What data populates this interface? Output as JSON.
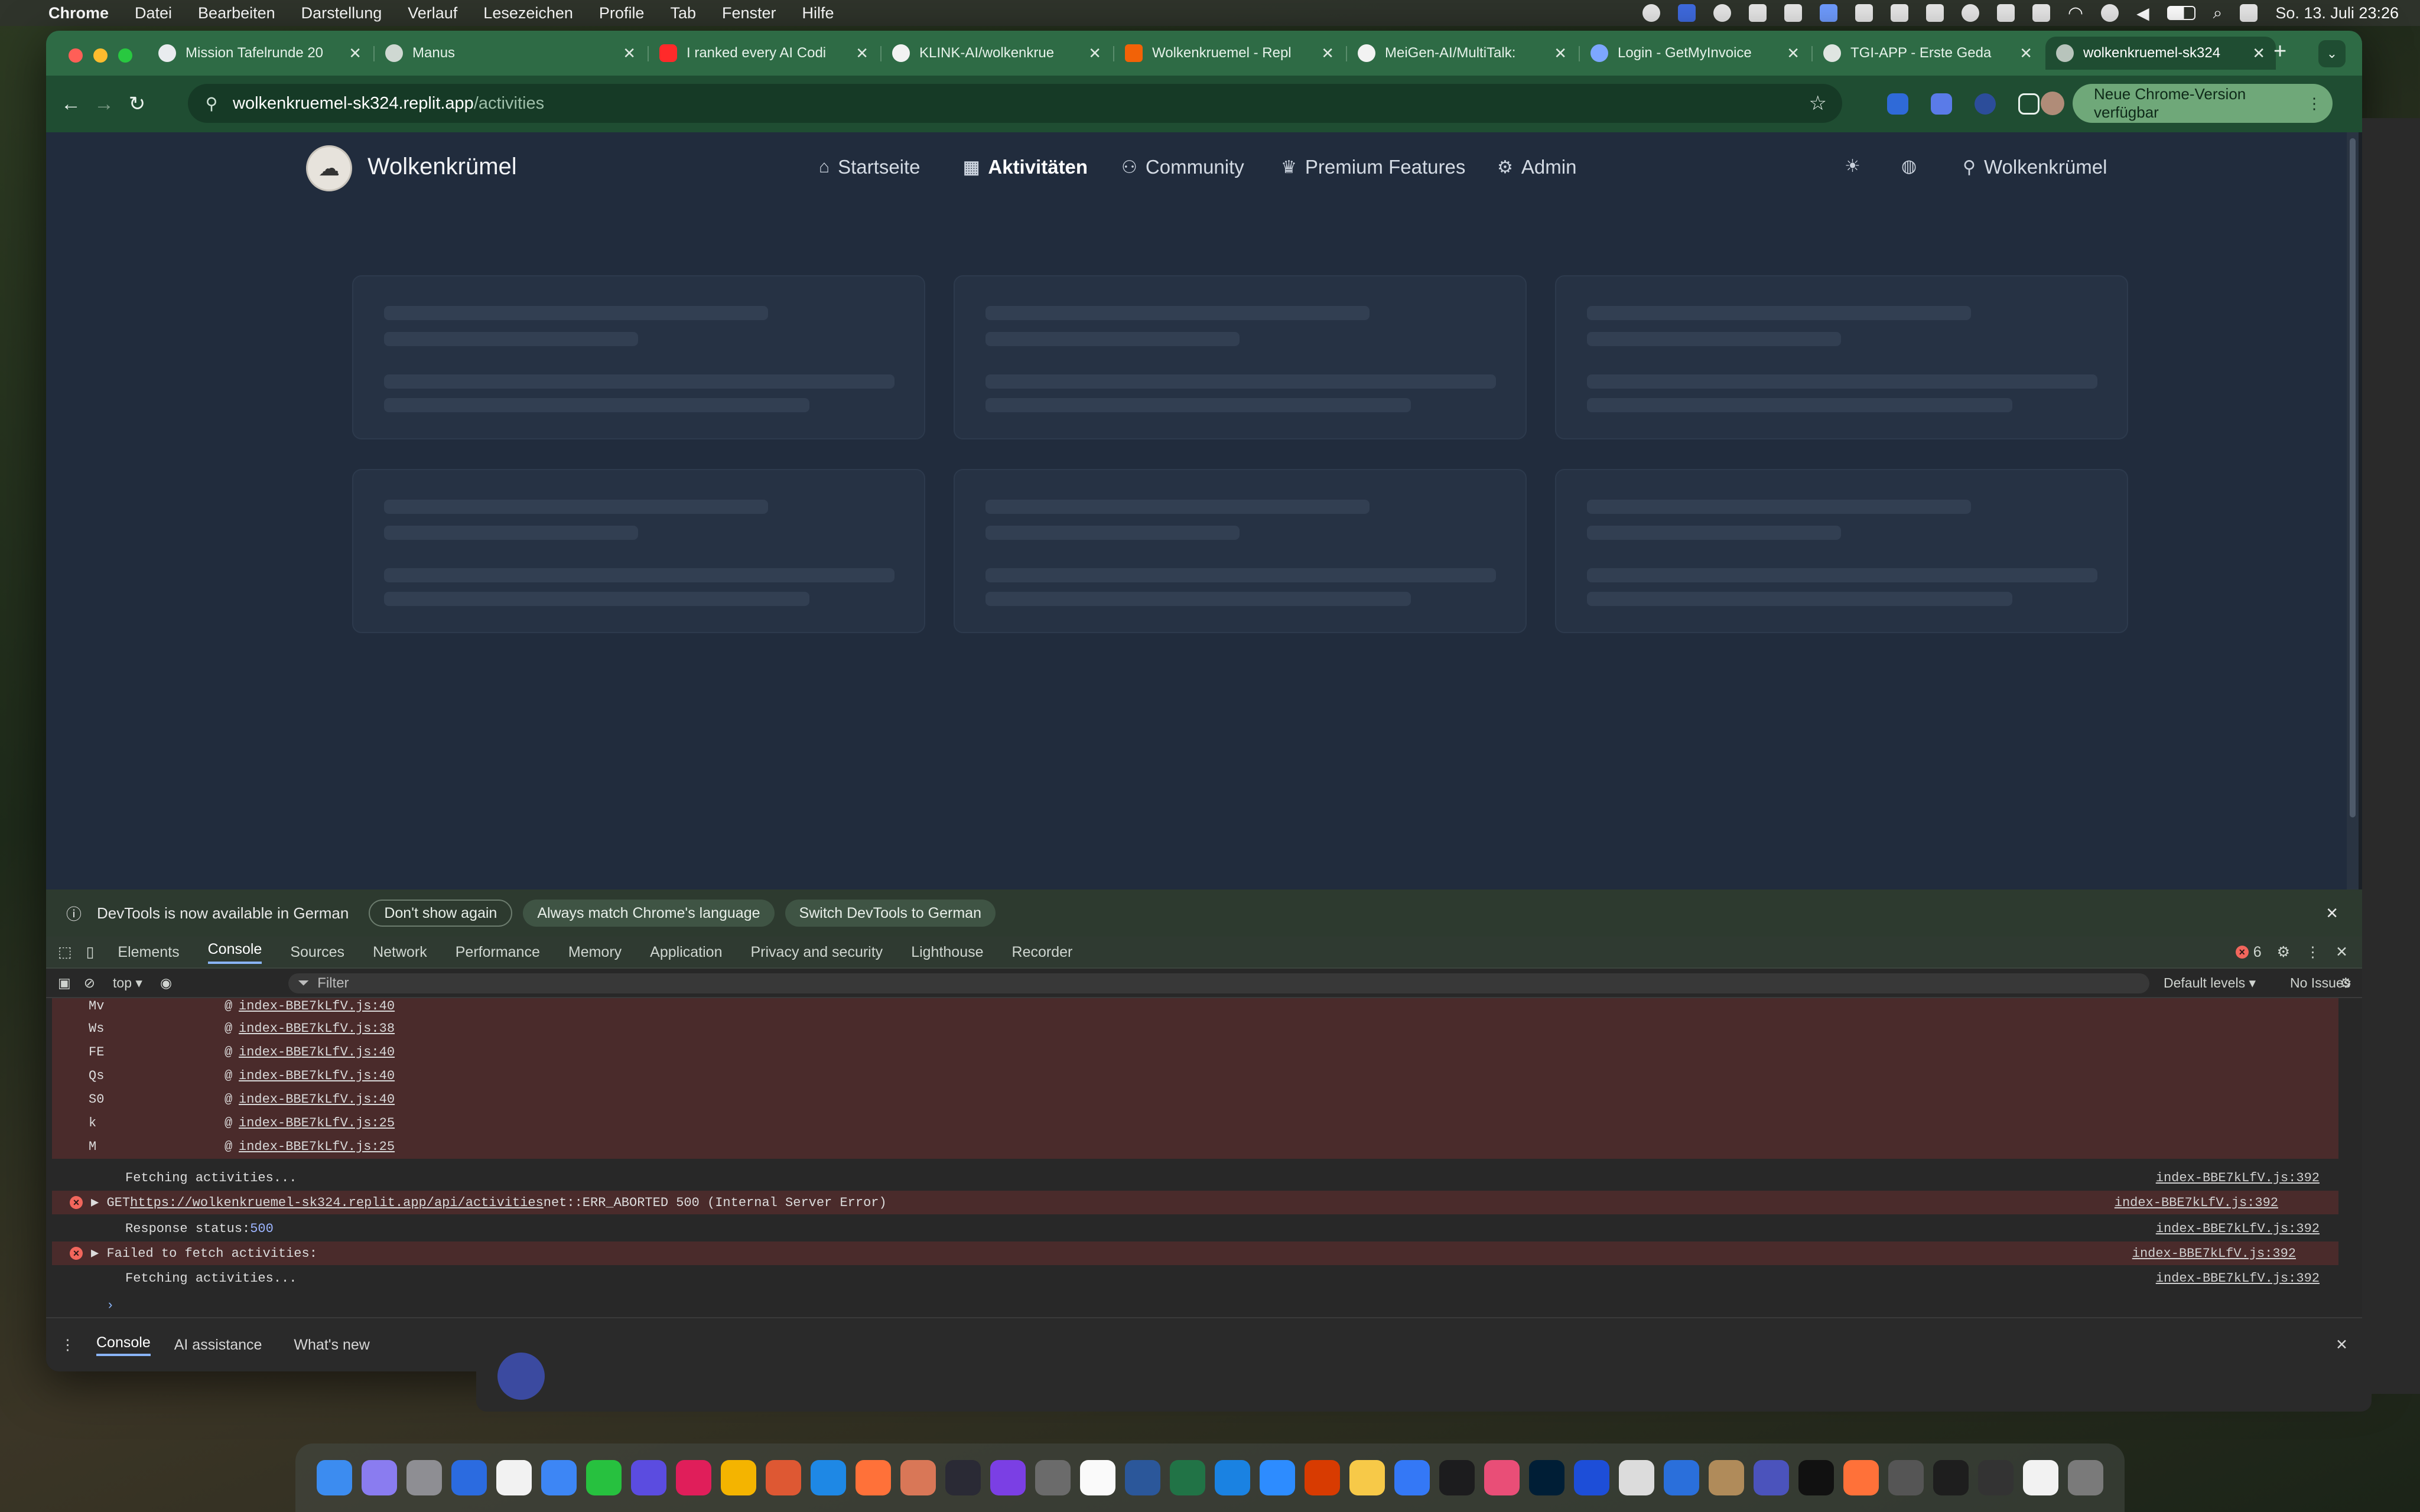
{
  "menubar": {
    "app": "Chrome",
    "items": [
      "Datei",
      "Bearbeiten",
      "Darstellung",
      "Verlauf",
      "Lesezeichen",
      "Profile",
      "Tab",
      "Fenster",
      "Hilfe"
    ],
    "datetime": "So. 13. Juli  23:26"
  },
  "tabs": [
    {
      "label": "Mission Tafelrunde 20",
      "icon": "google-icon"
    },
    {
      "label": "Manus",
      "icon": "manus-icon"
    },
    {
      "label": "I ranked every AI Codi",
      "icon": "youtube-icon"
    },
    {
      "label": "KLINK-AI/wolkenkrue",
      "icon": "github-icon"
    },
    {
      "label": "Wolkenkruemel - Repl",
      "icon": "replit-icon"
    },
    {
      "label": "MeiGen-AI/MultiTalk:",
      "icon": "github-icon"
    },
    {
      "label": "Login - GetMyInvoice",
      "icon": "globe-icon"
    },
    {
      "label": "TGI-APP - Erste Geda",
      "icon": "chatgpt-icon"
    },
    {
      "label": "wolkenkruemel-sk324",
      "icon": "globe-icon",
      "active": true
    }
  ],
  "new_tab": "+",
  "address": {
    "host": "wolkenkruemel-sk324.replit.app",
    "path": "/activities"
  },
  "update_button": "Neue Chrome-Version verfügbar",
  "site": {
    "brand": "Wolkenkrümel",
    "nav": [
      {
        "label": "Startseite",
        "icon": "home-icon"
      },
      {
        "label": "Aktivitäten",
        "icon": "calendar-icon",
        "active": true
      },
      {
        "label": "Community",
        "icon": "users-icon"
      },
      {
        "label": "Premium Features",
        "icon": "crown-icon"
      },
      {
        "label": "Admin",
        "icon": "gear-icon"
      }
    ],
    "user": "Wolkenkrümel"
  },
  "devtools": {
    "notice": "DevTools is now available in German",
    "btn_dont_show": "Don't show again",
    "btn_match": "Always match Chrome's language",
    "btn_switch": "Switch DevTools to German",
    "tabs": [
      "Elements",
      "Console",
      "Sources",
      "Network",
      "Performance",
      "Memory",
      "Application",
      "Privacy and security",
      "Lighthouse",
      "Recorder"
    ],
    "active_tab": "Console",
    "error_count": "6",
    "context": "top ▾",
    "filter_placeholder": "Filter",
    "levels": "Default levels ▾",
    "issues": "No Issues",
    "stack": [
      {
        "fn": "Mv",
        "src": "index-BBE7kLfV.js:40"
      },
      {
        "fn": "Ws",
        "src": "index-BBE7kLfV.js:38"
      },
      {
        "fn": "FE",
        "src": "index-BBE7kLfV.js:40"
      },
      {
        "fn": "Qs",
        "src": "index-BBE7kLfV.js:40"
      },
      {
        "fn": "S0",
        "src": "index-BBE7kLfV.js:40"
      },
      {
        "fn": "k",
        "src": "index-BBE7kLfV.js:25"
      },
      {
        "fn": "M",
        "src": "index-BBE7kLfV.js:25"
      }
    ],
    "log": [
      {
        "text": "Fetching activities...",
        "src": "index-BBE7kLfV.js:392",
        "error": false
      },
      {
        "prefix": "▶ GET ",
        "link": "https://wolkenkruemel-sk324.replit.app/api/activities",
        "text": " net::ERR_ABORTED 500 (Internal Server Error)",
        "src": "index-BBE7kLfV.js:392",
        "error": true
      },
      {
        "text": "Response status: ",
        "value": "500",
        "src": "index-BBE7kLfV.js:392",
        "error": false
      },
      {
        "text": "▶ Failed to fetch activities:",
        "src": "index-BBE7kLfV.js:392",
        "error": true
      },
      {
        "text": "Fetching activities...",
        "src": "index-BBE7kLfV.js:392",
        "error": false
      }
    ],
    "drawer_tabs": [
      "Console",
      "AI assistance",
      "What's new"
    ]
  }
}
